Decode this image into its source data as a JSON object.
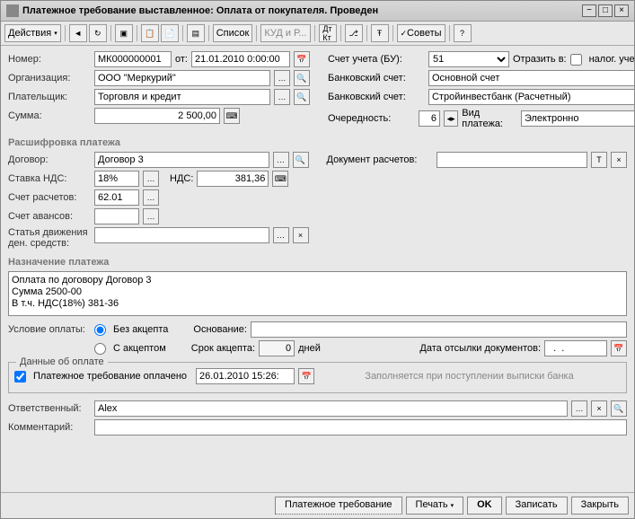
{
  "title": "Платежное требование выставленное: Оплата от покупателя. Проведен",
  "toolbar": {
    "actions": "Действия",
    "list": "Список",
    "kudir": "КУД и Р...",
    "advice": "Советы"
  },
  "left": {
    "number_lbl": "Номер:",
    "number": "МК000000001",
    "from_lbl": "от:",
    "date": "21.01.2010 0:00:00",
    "org_lbl": "Организация:",
    "org": "ООО \"Меркурий\"",
    "payer_lbl": "Плательщик:",
    "payer": "Торговля и кредит",
    "sum_lbl": "Сумма:",
    "sum": "2 500,00"
  },
  "right": {
    "account_lbl": "Счет учета (БУ):",
    "account": "51",
    "reflect_lbl": "Отразить в:",
    "tax_lbl": "налог. учете",
    "bank1_lbl": "Банковский счет:",
    "bank1": "Основной счет",
    "bank2_lbl": "Банковский счет:",
    "bank2": "Стройинвестбанк (Расчетный)",
    "priority_lbl": "Очередность:",
    "priority": "6",
    "paytype_lbl": "Вид платежа:",
    "paytype": "Электронно"
  },
  "decode_hdr": "Расшифровка платежа",
  "decode": {
    "contract_lbl": "Договор:",
    "contract": "Договор 3",
    "calcdoc_lbl": "Документ расчетов:",
    "calcdoc": "",
    "vatrate_lbl": "Ставка НДС:",
    "vatrate": "18%",
    "vat_lbl": "НДС:",
    "vat": "381,36",
    "calcacc_lbl": "Счет расчетов:",
    "calcacc": "62.01",
    "advacc_lbl": "Счет авансов:",
    "advacc": "",
    "flowitem_lbl": "Статья движения ден. средств:",
    "flowitem": ""
  },
  "purpose_hdr": "Назначение платежа",
  "purpose": "Оплата по договору Договор 3\nСумма 2500-00\nВ т.ч. НДС(18%) 381-36",
  "paycond": {
    "lbl": "Условие оплаты:",
    "no_accept": "Без акцепта",
    "with_accept": "С акцептом",
    "basis_lbl": "Основание:",
    "accept_term_lbl": "Срок акцепта:",
    "accept_term": "0",
    "days": "дней",
    "senddate_lbl": "Дата отсылки документов:",
    "senddate": "  .  .    "
  },
  "paydata": {
    "legend": "Данные об оплате",
    "paid_lbl": "Платежное требование оплачено",
    "paid_date": "26.01.2010 15:26:",
    "note": "Заполняется при поступлении выписки банка"
  },
  "resp_lbl": "Ответственный:",
  "resp": "Alex",
  "comment_lbl": "Комментарий:",
  "comment": "",
  "footer": {
    "doc": "Платежное требование",
    "print": "Печать",
    "ok": "OK",
    "save": "Записать",
    "close": "Закрыть"
  }
}
